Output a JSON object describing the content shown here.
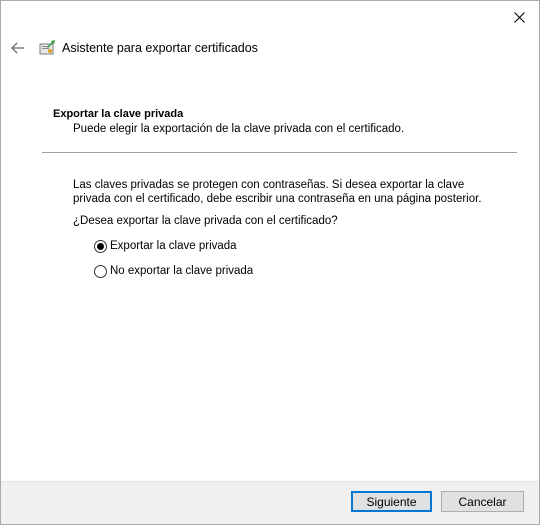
{
  "window": {
    "title": "Asistente para exportar certificados",
    "icons": {
      "close": "close-icon",
      "back": "back-arrow-icon",
      "wizard": "certificate-wizard-icon"
    }
  },
  "section": {
    "heading": "Exportar la clave privada",
    "subheading": "Puede elegir la exportación de la clave privada con el certificado."
  },
  "body": {
    "description": "Las claves privadas se protegen con contraseñas. Si desea exportar la clave privada con el certificado, debe escribir una contraseña en una página posterior.",
    "question": "¿Desea exportar la clave privada con el certificado?",
    "options": [
      {
        "label": "Exportar la clave privada",
        "selected": true
      },
      {
        "label": "No exportar la clave privada",
        "selected": false
      }
    ]
  },
  "footer": {
    "next_label": "Siguiente",
    "cancel_label": "Cancelar"
  },
  "colors": {
    "accent": "#0078d7",
    "footer_bg": "#f0f0f0",
    "button_bg": "#e1e1e1"
  }
}
